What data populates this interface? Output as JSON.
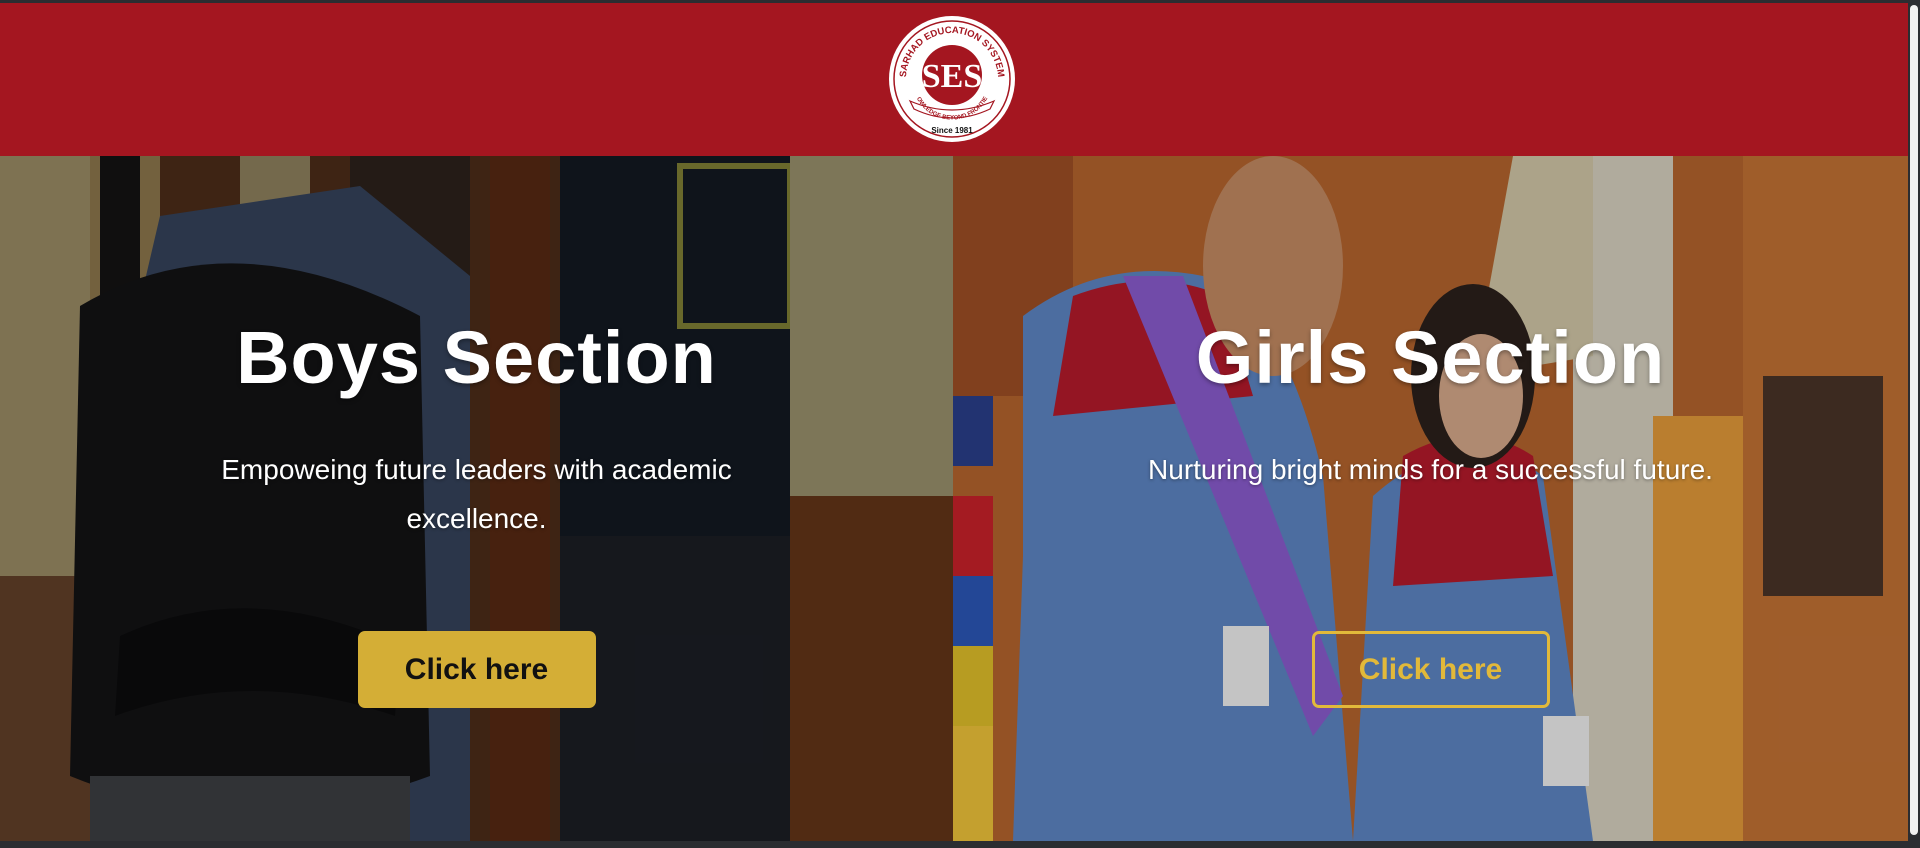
{
  "logo": {
    "ring_text": "SARHAD EDUCATION SYSTEM",
    "monogram": "SES",
    "motto": "KNOWLEDGE BEYOND FRONTIERS",
    "since": "Since 1981"
  },
  "sections": [
    {
      "title": "Boys Section",
      "description": "Empoweing future leaders with academic excellence.",
      "button_label": "Click here"
    },
    {
      "title": "Girls Section",
      "description": "Nurturing bright minds for a successful future.",
      "button_label": "Click here"
    }
  ],
  "colors": {
    "header": "#a41620",
    "accent": "#d4ae36"
  }
}
